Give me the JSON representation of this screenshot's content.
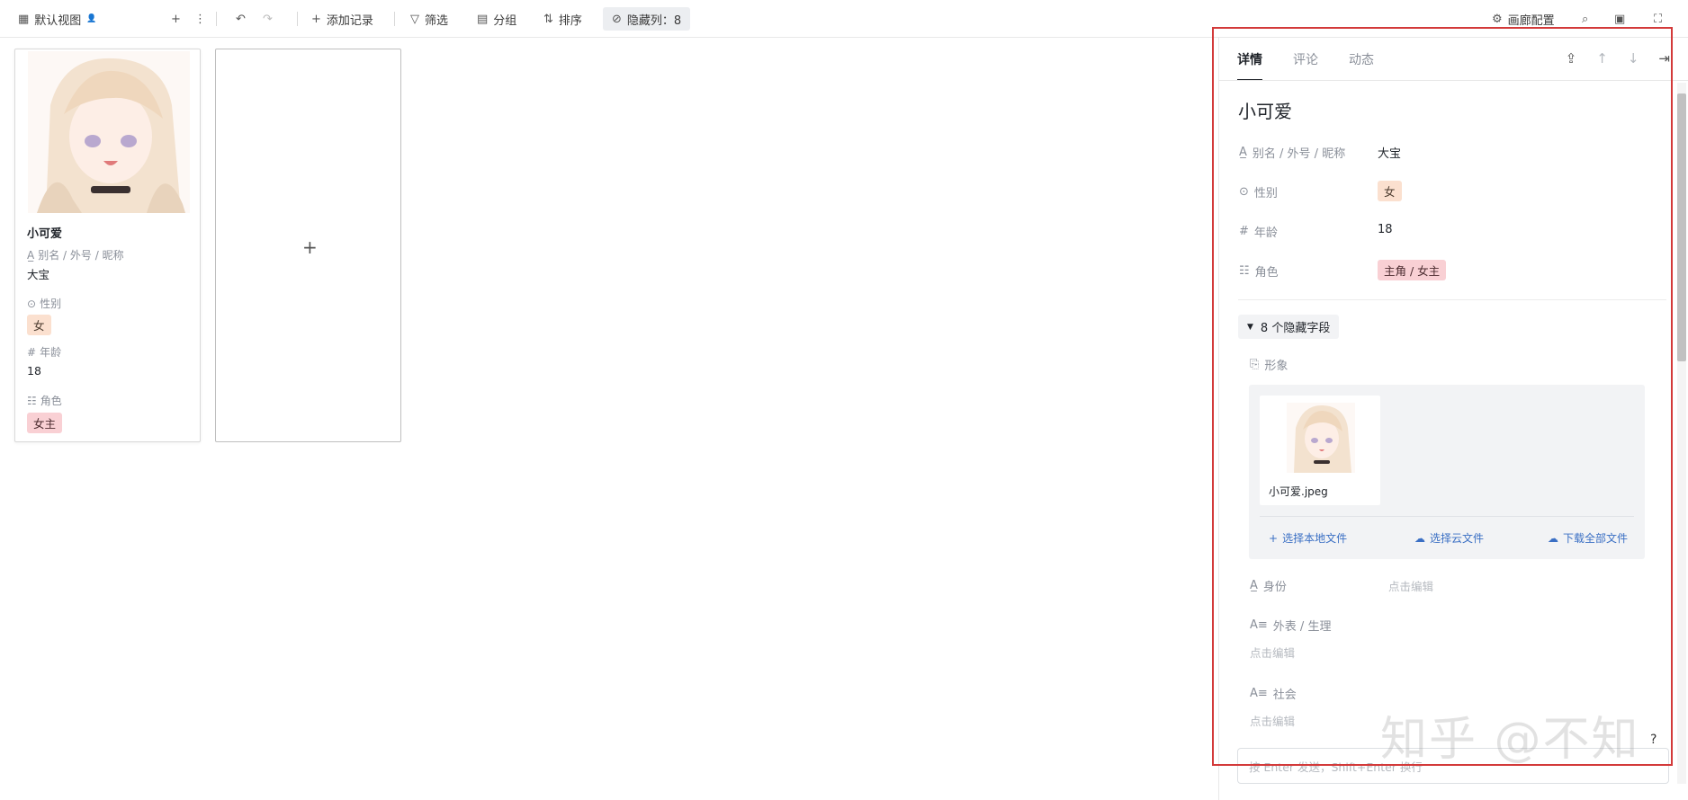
{
  "toolbar": {
    "view_name": "默认视图",
    "add_record": "添加记录",
    "filter": "筛选",
    "group": "分组",
    "sort": "排序",
    "hidden_cols": "隐藏列：8",
    "gallery_config": "画廊配置"
  },
  "card": {
    "name": "小可爱",
    "alias_label": "别名 / 外号 / 昵称",
    "alias_value": "大宝",
    "gender_label": "性别",
    "gender_value": "女",
    "age_label": "年龄",
    "age_value": "18",
    "role_label": "角色",
    "role_value": "女主"
  },
  "panel": {
    "tabs": [
      "详情",
      "评论",
      "动态"
    ],
    "title": "小可爱",
    "fields": {
      "alias_label": "别名 / 外号 / 昵称",
      "alias_value": "大宝",
      "gender_label": "性别",
      "gender_value": "女",
      "age_label": "年龄",
      "age_value": "18",
      "role_label": "角色",
      "role_value": "主角 / 女主"
    },
    "hidden_toggle": "8 个隐藏字段",
    "image_label": "形象",
    "file_name": "小可爱.jpeg",
    "local_file": "选择本地文件",
    "cloud_file": "选择云文件",
    "download_all": "下载全部文件",
    "identity_label": "身份",
    "appearance_label": "外表 / 生理",
    "social_label": "社会",
    "edit_placeholder": "点击编辑",
    "comment_placeholder": "按 Enter 发送，Shift+Enter 换行"
  },
  "watermark": "知乎 @不知",
  "colors": {
    "peach_tag": "#fbe0cf",
    "pink_tag": "#f9d0d4",
    "link_blue": "#3a6fc4",
    "frame_red": "#d33a3a"
  }
}
